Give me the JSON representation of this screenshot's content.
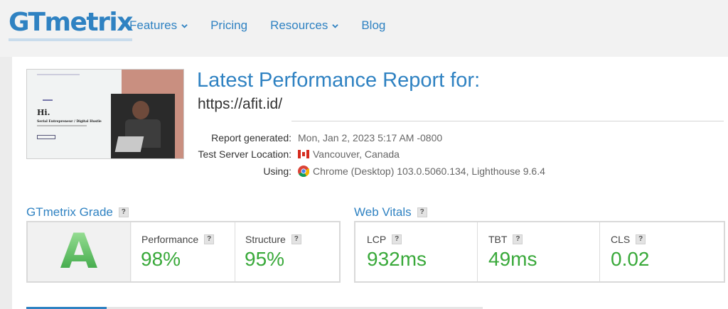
{
  "brand": {
    "logo_gt": "GT",
    "logo_rest": "metrix",
    "primary_color": "#2f82c2",
    "grade_color": "#3fb44a"
  },
  "nav": {
    "items": [
      {
        "label": "Features",
        "icon": "chevron-down-icon"
      },
      {
        "label": "Pricing"
      },
      {
        "label": "Resources",
        "icon": "chevron-down-icon"
      },
      {
        "label": "Blog"
      }
    ]
  },
  "thumbnail": {
    "heading": "Hi.",
    "subheading": "Serial Entrepreneur / Digital Hustle"
  },
  "report": {
    "title": "Latest Performance Report for:",
    "url": "https://afit.id/",
    "rows": [
      {
        "label": "Report generated:",
        "value": "Mon, Jan 2, 2023 5:17 AM -0800"
      },
      {
        "label": "Test Server Location:",
        "value": "Vancouver, Canada",
        "icon": "canada-flag-icon"
      },
      {
        "label": "Using:",
        "value": "Chrome (Desktop) 103.0.5060.134, Lighthouse 9.6.4",
        "icon": "chrome-icon"
      }
    ]
  },
  "grade_section": {
    "title": "GTmetrix Grade",
    "help": "?",
    "grade": "A",
    "metrics": [
      {
        "label": "Performance",
        "value": "98%"
      },
      {
        "label": "Structure",
        "value": "95%"
      }
    ]
  },
  "vitals_section": {
    "title": "Web Vitals",
    "help": "?",
    "metrics": [
      {
        "label": "LCP",
        "value": "932ms"
      },
      {
        "label": "TBT",
        "value": "49ms"
      },
      {
        "label": "CLS",
        "value": "0.02"
      }
    ]
  }
}
